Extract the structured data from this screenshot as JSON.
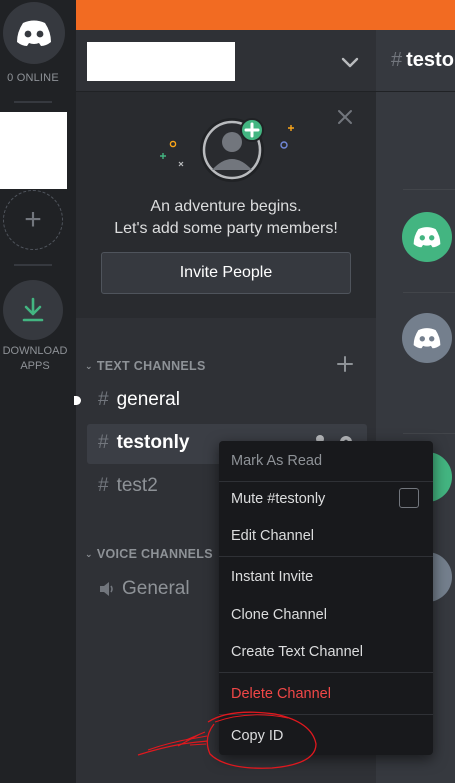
{
  "rail": {
    "online_count": "0 ONLINE",
    "add_server_glyph": "+",
    "download_label_1": "DOWNLOAD",
    "download_label_2": "APPS"
  },
  "server": {
    "invite_card": {
      "line1": "An adventure begins.",
      "line2": "Let's add some party members!",
      "invite_button": "Invite People"
    },
    "categories": {
      "text": "TEXT CHANNELS",
      "voice": "VOICE CHANNELS"
    },
    "text_channels": [
      "general",
      "testonly",
      "test2"
    ],
    "voice_channels": [
      "General"
    ],
    "selected_channel": "testonly"
  },
  "chat": {
    "title_prefix": "#",
    "title": "testonly"
  },
  "context_menu": {
    "items": [
      {
        "label": "Mark As Read",
        "state": "disabled"
      },
      {
        "label": "Mute #testonly",
        "state": "checkbox-unchecked"
      },
      {
        "label": "Edit Channel"
      },
      {
        "label": "Instant Invite"
      },
      {
        "label": "Clone Channel"
      },
      {
        "label": "Create Text Channel"
      },
      {
        "label": "Delete Channel",
        "state": "danger"
      },
      {
        "label": "Copy ID"
      }
    ]
  },
  "colors": {
    "accent_banner": "#f26b22",
    "discord_green": "#43b581",
    "discord_grey_avatar": "#747f8d",
    "danger": "#f04747",
    "scribble": "#e0181e"
  },
  "icons": [
    "discord-logo-icon",
    "plus-icon",
    "download-icon",
    "chevron-down-icon",
    "close-icon",
    "hash-icon",
    "lock-icon",
    "speaker-icon",
    "add-user-icon",
    "gear-icon",
    "checkbox-icon"
  ]
}
